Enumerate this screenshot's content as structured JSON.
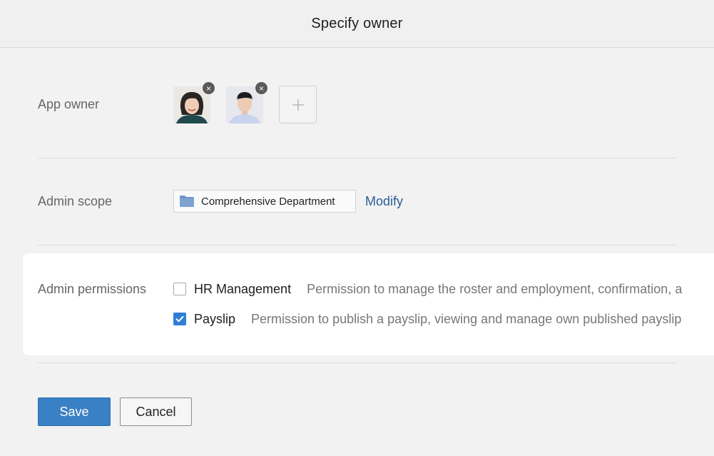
{
  "header": {
    "title": "Specify owner"
  },
  "owner": {
    "label": "App owner",
    "avatars": [
      {
        "name": "owner-avatar-1",
        "remove_glyph": "×"
      },
      {
        "name": "owner-avatar-2",
        "remove_glyph": "×"
      }
    ],
    "add_icon": "plus-icon"
  },
  "scope": {
    "label": "Admin scope",
    "chip_icon": "folder-icon",
    "chip_text": "Comprehensive Department",
    "modify_label": "Modify"
  },
  "permissions": {
    "label": "Admin permissions",
    "items": [
      {
        "name": "HR Management",
        "checked": false,
        "description": "Permission to manage the roster and employment, confirmation, a"
      },
      {
        "name": "Payslip",
        "checked": true,
        "description": "Permission to publish a payslip, viewing and manage own published payslip"
      }
    ]
  },
  "actions": {
    "save_label": "Save",
    "cancel_label": "Cancel"
  },
  "colors": {
    "primary": "#3a80c4",
    "link": "#2b5d96",
    "checkbox": "#2f7fd6"
  }
}
